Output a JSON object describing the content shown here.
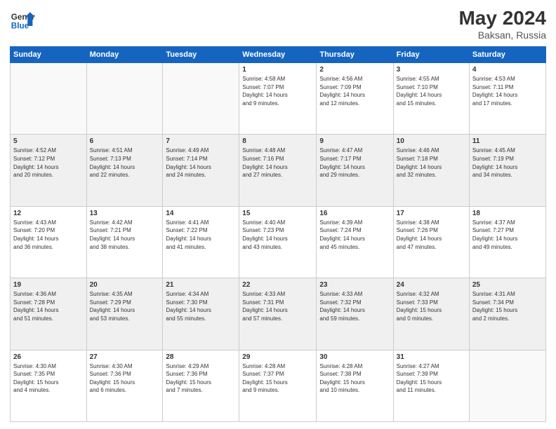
{
  "header": {
    "logo_line1": "General",
    "logo_line2": "Blue",
    "month": "May 2024",
    "location": "Baksan, Russia"
  },
  "weekdays": [
    "Sunday",
    "Monday",
    "Tuesday",
    "Wednesday",
    "Thursday",
    "Friday",
    "Saturday"
  ],
  "weeks": [
    [
      {
        "day": "",
        "info": ""
      },
      {
        "day": "",
        "info": ""
      },
      {
        "day": "",
        "info": ""
      },
      {
        "day": "1",
        "info": "Sunrise: 4:58 AM\nSunset: 7:07 PM\nDaylight: 14 hours\nand 9 minutes."
      },
      {
        "day": "2",
        "info": "Sunrise: 4:56 AM\nSunset: 7:09 PM\nDaylight: 14 hours\nand 12 minutes."
      },
      {
        "day": "3",
        "info": "Sunrise: 4:55 AM\nSunset: 7:10 PM\nDaylight: 14 hours\nand 15 minutes."
      },
      {
        "day": "4",
        "info": "Sunrise: 4:53 AM\nSunset: 7:11 PM\nDaylight: 14 hours\nand 17 minutes."
      }
    ],
    [
      {
        "day": "5",
        "info": "Sunrise: 4:52 AM\nSunset: 7:12 PM\nDaylight: 14 hours\nand 20 minutes."
      },
      {
        "day": "6",
        "info": "Sunrise: 4:51 AM\nSunset: 7:13 PM\nDaylight: 14 hours\nand 22 minutes."
      },
      {
        "day": "7",
        "info": "Sunrise: 4:49 AM\nSunset: 7:14 PM\nDaylight: 14 hours\nand 24 minutes."
      },
      {
        "day": "8",
        "info": "Sunrise: 4:48 AM\nSunset: 7:16 PM\nDaylight: 14 hours\nand 27 minutes."
      },
      {
        "day": "9",
        "info": "Sunrise: 4:47 AM\nSunset: 7:17 PM\nDaylight: 14 hours\nand 29 minutes."
      },
      {
        "day": "10",
        "info": "Sunrise: 4:46 AM\nSunset: 7:18 PM\nDaylight: 14 hours\nand 32 minutes."
      },
      {
        "day": "11",
        "info": "Sunrise: 4:45 AM\nSunset: 7:19 PM\nDaylight: 14 hours\nand 34 minutes."
      }
    ],
    [
      {
        "day": "12",
        "info": "Sunrise: 4:43 AM\nSunset: 7:20 PM\nDaylight: 14 hours\nand 36 minutes."
      },
      {
        "day": "13",
        "info": "Sunrise: 4:42 AM\nSunset: 7:21 PM\nDaylight: 14 hours\nand 38 minutes."
      },
      {
        "day": "14",
        "info": "Sunrise: 4:41 AM\nSunset: 7:22 PM\nDaylight: 14 hours\nand 41 minutes."
      },
      {
        "day": "15",
        "info": "Sunrise: 4:40 AM\nSunset: 7:23 PM\nDaylight: 14 hours\nand 43 minutes."
      },
      {
        "day": "16",
        "info": "Sunrise: 4:39 AM\nSunset: 7:24 PM\nDaylight: 14 hours\nand 45 minutes."
      },
      {
        "day": "17",
        "info": "Sunrise: 4:38 AM\nSunset: 7:26 PM\nDaylight: 14 hours\nand 47 minutes."
      },
      {
        "day": "18",
        "info": "Sunrise: 4:37 AM\nSunset: 7:27 PM\nDaylight: 14 hours\nand 49 minutes."
      }
    ],
    [
      {
        "day": "19",
        "info": "Sunrise: 4:36 AM\nSunset: 7:28 PM\nDaylight: 14 hours\nand 51 minutes."
      },
      {
        "day": "20",
        "info": "Sunrise: 4:35 AM\nSunset: 7:29 PM\nDaylight: 14 hours\nand 53 minutes."
      },
      {
        "day": "21",
        "info": "Sunrise: 4:34 AM\nSunset: 7:30 PM\nDaylight: 14 hours\nand 55 minutes."
      },
      {
        "day": "22",
        "info": "Sunrise: 4:33 AM\nSunset: 7:31 PM\nDaylight: 14 hours\nand 57 minutes."
      },
      {
        "day": "23",
        "info": "Sunrise: 4:33 AM\nSunset: 7:32 PM\nDaylight: 14 hours\nand 59 minutes."
      },
      {
        "day": "24",
        "info": "Sunrise: 4:32 AM\nSunset: 7:33 PM\nDaylight: 15 hours\nand 0 minutes."
      },
      {
        "day": "25",
        "info": "Sunrise: 4:31 AM\nSunset: 7:34 PM\nDaylight: 15 hours\nand 2 minutes."
      }
    ],
    [
      {
        "day": "26",
        "info": "Sunrise: 4:30 AM\nSunset: 7:35 PM\nDaylight: 15 hours\nand 4 minutes."
      },
      {
        "day": "27",
        "info": "Sunrise: 4:30 AM\nSunset: 7:36 PM\nDaylight: 15 hours\nand 6 minutes."
      },
      {
        "day": "28",
        "info": "Sunrise: 4:29 AM\nSunset: 7:36 PM\nDaylight: 15 hours\nand 7 minutes."
      },
      {
        "day": "29",
        "info": "Sunrise: 4:28 AM\nSunset: 7:37 PM\nDaylight: 15 hours\nand 9 minutes."
      },
      {
        "day": "30",
        "info": "Sunrise: 4:28 AM\nSunset: 7:38 PM\nDaylight: 15 hours\nand 10 minutes."
      },
      {
        "day": "31",
        "info": "Sunrise: 4:27 AM\nSunset: 7:39 PM\nDaylight: 15 hours\nand 11 minutes."
      },
      {
        "day": "",
        "info": ""
      }
    ]
  ]
}
